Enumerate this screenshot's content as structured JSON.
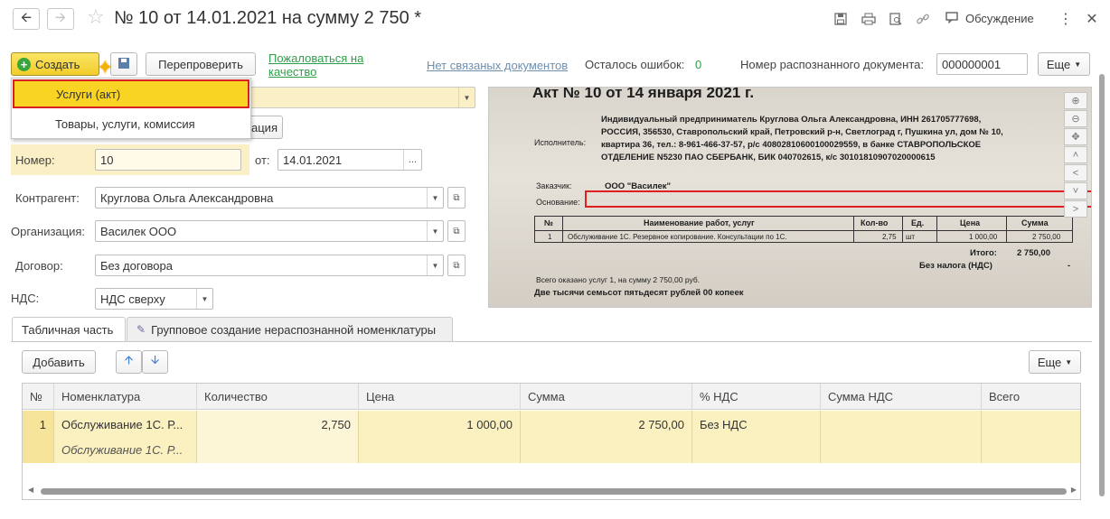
{
  "window": {
    "title": "№ 10 от 14.01.2021 на сумму 2 750 *",
    "discussion_label": "Обсуждение"
  },
  "toolbar": {
    "create_label": "Создать",
    "recheck_label": "Перепроверить",
    "complain_label": "Пожаловаться на качество",
    "no_linked_docs_label": "Нет связаных документов",
    "errors_left_label": "Осталось ошибок:",
    "errors_left_value": "0",
    "recognized_doc_number_label": "Номер распознанного документа:",
    "recognized_doc_number_value": "000000001",
    "more_label": "Еще"
  },
  "create_menu": {
    "items": [
      {
        "label": "Услуги (акт)",
        "selected": true
      },
      {
        "label": "Товары, услуги, комиссия",
        "selected": false
      }
    ]
  },
  "form": {
    "hidden_button_partial": "ация",
    "number_label": "Номер:",
    "number_value": "10",
    "date_label": "от:",
    "date_value": "14.01.2021",
    "counterparty_label": "Контрагент:",
    "counterparty_value": "Круглова Ольга Александровна",
    "organization_label": "Организация:",
    "organization_value": "Василек ООО",
    "contract_label": "Договор:",
    "contract_value": "Без договора",
    "vat_label": "НДС:",
    "vat_value": "НДС сверху"
  },
  "scan": {
    "heading": "Акт № 10 от 14 января 2021 г.",
    "executor_label": "Исполнитель:",
    "executor_lines": [
      "Индивидуальный предприниматель Круглова Ольга Александровна, ИНН 261705777698,",
      "РОССИЯ, 356530, Ставропольский край, Петровский р-н, Светлоград г, Пушкина ул, дом № 10,",
      "квартира 36, тел.: 8-961-466-37-57, р/с 40802810600100029559, в банке СТАВРОПОЛЬСКОЕ",
      "ОТДЕЛЕНИЕ N5230 ПАО СБЕРБАНК, БИК 040702615, к/с 30101810907020000615"
    ],
    "customer_label": "Заказчик:",
    "customer_value": "ООО \"Василек\"",
    "basis_label": "Основание:",
    "table_headers": [
      "№",
      "Наименование работ, услуг",
      "Кол-во",
      "Ед.",
      "Цена",
      "Сумма"
    ],
    "table_row": [
      "1",
      "Обслуживание 1С. Резервное копирование. Консультации по 1С.",
      "2,75",
      "шт",
      "1 000,00",
      "2 750,00"
    ],
    "total_label": "Итого:",
    "total_value": "2 750,00",
    "no_vat_label": "Без налога (НДС)",
    "no_vat_value": "-",
    "summary_line": "Всего оказано услуг 1, на сумму 2 750,00 руб.",
    "amount_words": "Две тысячи семьсот пятьдесят рублей 00 копеек"
  },
  "tabs": [
    {
      "label": "Табличная часть",
      "active": true
    },
    {
      "label": "Групповое создание нераспознанной номенклатуры",
      "active": false
    }
  ],
  "table_toolbar": {
    "add_label": "Добавить",
    "more_label": "Еще"
  },
  "table": {
    "columns": [
      "№",
      "Номенклатура",
      "Количество",
      "Цена",
      "Сумма",
      "% НДС",
      "Сумма НДС",
      "Всего"
    ],
    "rows": [
      {
        "num": "1",
        "nomenclature": "Обслуживание 1С. Р...",
        "nomenclature_sub": "Обслуживание 1С. Р...",
        "quantity": "2,750",
        "price": "1 000,00",
        "sum": "2 750,00",
        "vat_rate": "Без НДС",
        "vat_sum": "",
        "total": ""
      }
    ]
  }
}
